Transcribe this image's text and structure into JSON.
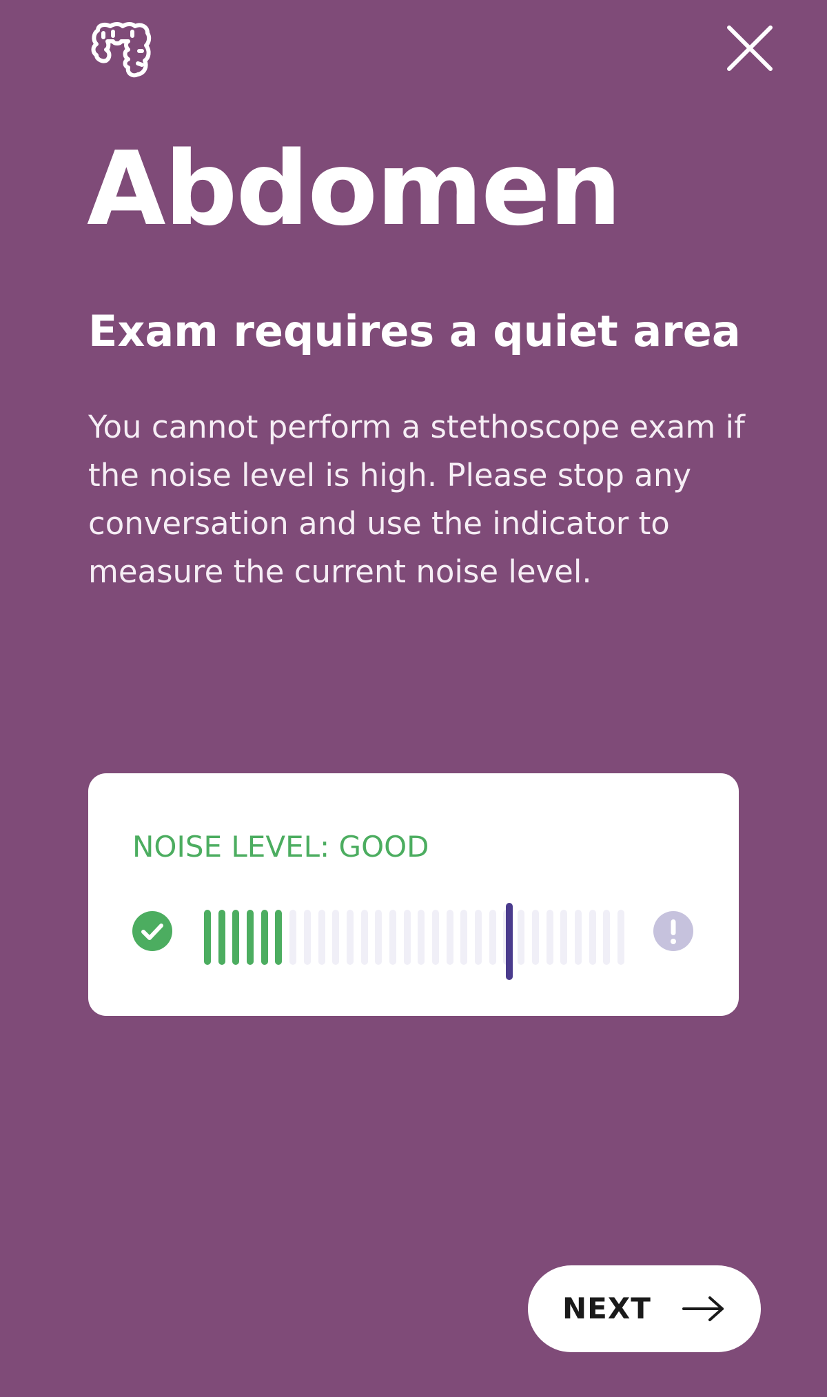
{
  "header": {
    "organ_icon": "intestine-icon",
    "close_icon": "close-icon"
  },
  "page": {
    "title": "Abdomen",
    "heading": "Exam requires a quiet area",
    "description": "You cannot perform a stethoscope exam if the noise level is high. Please stop any conversation and use the indicator to measure the current noise level."
  },
  "noise_meter": {
    "label": "NOISE LEVEL: GOOD",
    "status_icon": "check-circle-icon",
    "warning_icon": "exclamation-circle-icon",
    "total_bars": 30,
    "active_bars": 6,
    "threshold_fraction": 0.73,
    "colors": {
      "good": "#4cad60",
      "inactive": "#f0eff7",
      "threshold": "#4a3b8d",
      "warning": "#c6c2dd"
    }
  },
  "footer": {
    "next_label": "NEXT",
    "next_icon": "arrow-right-icon"
  },
  "theme": {
    "background": "#7f4b78",
    "card": "#ffffff"
  }
}
